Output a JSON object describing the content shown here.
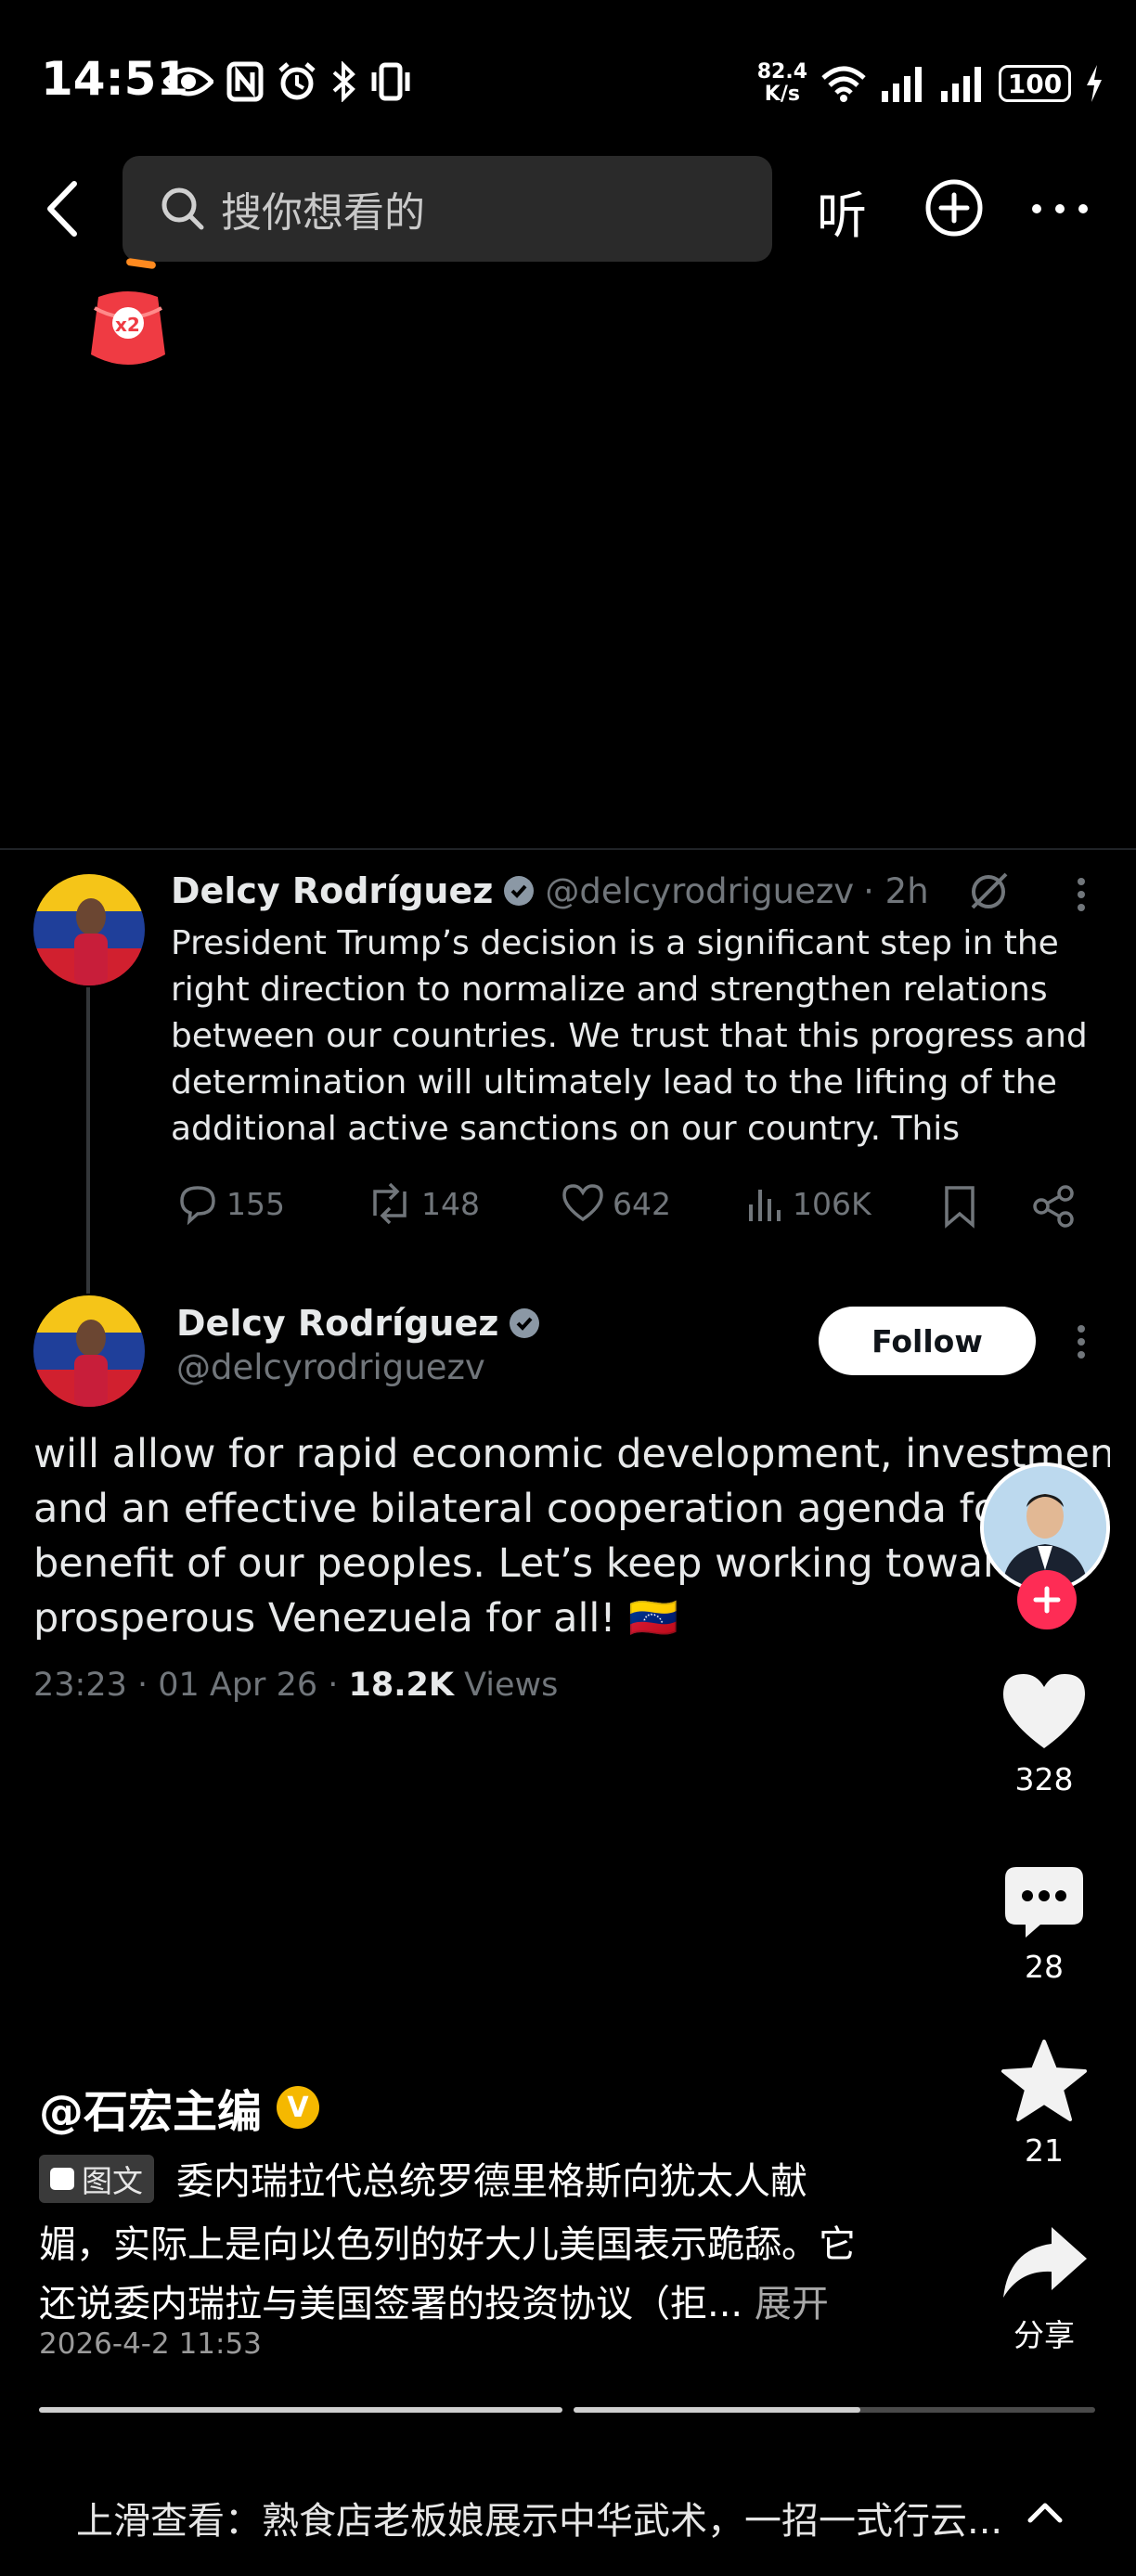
{
  "status_bar": {
    "time": "14:51",
    "net_speed_value": "82.4",
    "net_speed_unit": "K/s",
    "battery": "100"
  },
  "top_bar": {
    "search_placeholder": "搜你想看的",
    "listen_label": "听"
  },
  "red_packet": {
    "label": "x2"
  },
  "tweet_parent": {
    "name": "Delcy Rodríguez",
    "handle": "@delcyrodriguezv",
    "age": "· 2h",
    "text": "President Trump’s decision is a significant step in the right direction to normalize and strengthen relations between our countries. We trust that this progress and determination will ultimately lead to the lifting of the additional active sanctions on our country. This",
    "replies": "155",
    "reposts": "148",
    "likes": "642",
    "views": "106K"
  },
  "tweet_main": {
    "name": "Delcy Rodríguez",
    "handle": "@delcyrodriguezv",
    "follow_label": "Follow",
    "text_lines": [
      "will allow for rapid economic development, investment,",
      "and an effective bilateral cooperation agenda for the",
      "benefit of our peoples. Let’s keep working toward a",
      "prosperous Venezuela for all! 🇻🇪"
    ],
    "timestamp": "23:23 · 01 Apr 26 · ",
    "views_count": "18.2K",
    "views_label": " Views"
  },
  "right_rail": {
    "likes": "328",
    "comments": "28",
    "favorites": "21",
    "share_label": "分享"
  },
  "caption": {
    "author": "@石宏主编",
    "verified_badge": "V",
    "tag_label": "图文",
    "line1": "委内瑞拉代总统罗德里格斯向犹太人献",
    "line2": "媚，实际上是向以色列的好大儿美国表示跪舔。它",
    "line3": "还说委内瑞拉与美国签署的投资协议（拒...",
    "expand_label": " 展开",
    "date": "2026-4-2 11:53"
  },
  "progress": {
    "current_segment_fill": 0.55
  },
  "next_video": {
    "hint": "上滑查看：熟食店老板娘展示中华武术，一招一式行云..."
  }
}
